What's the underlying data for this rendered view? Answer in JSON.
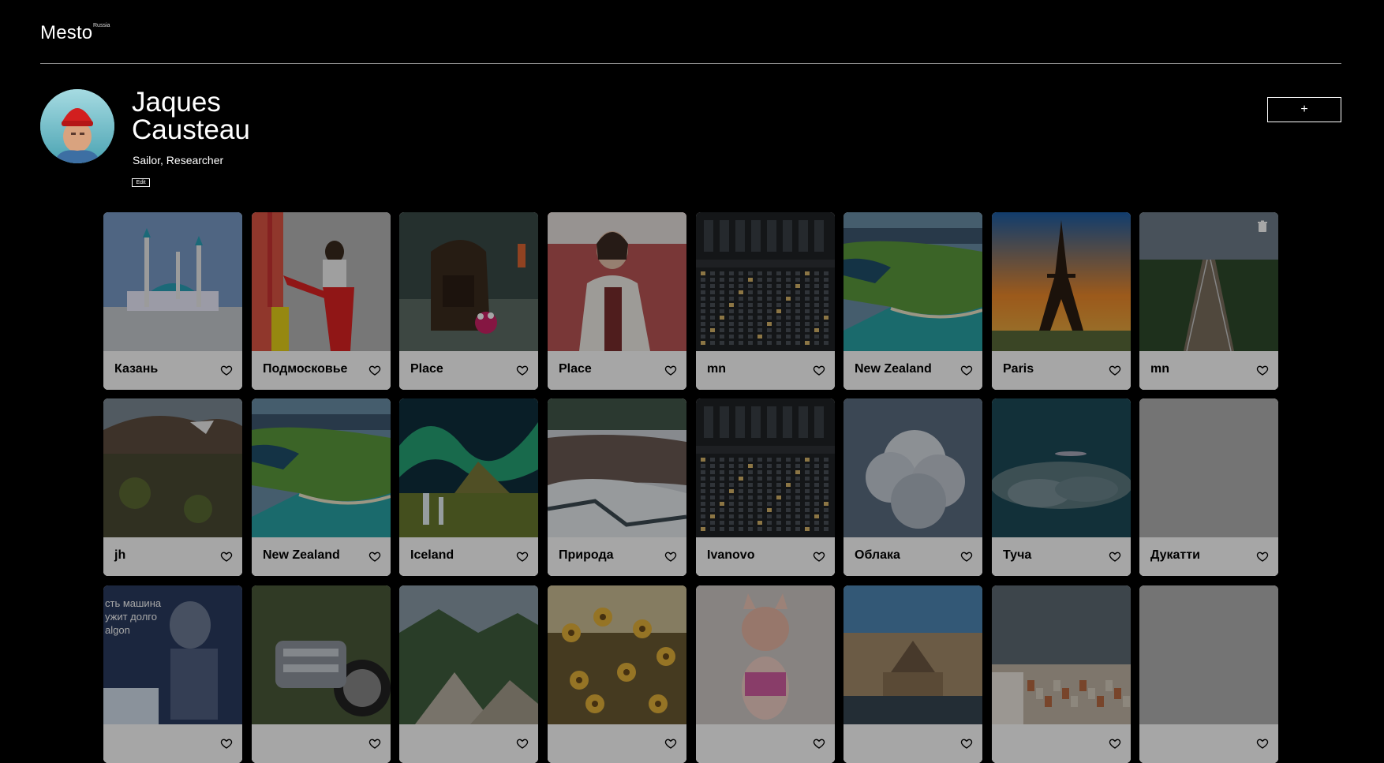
{
  "header": {
    "logo": "Mesto",
    "logo_sup": "Russia"
  },
  "profile": {
    "name": "Jaques Causteau",
    "about": "Sailor, Researcher",
    "edit_label": "Edit",
    "add_label": "+"
  },
  "cards": [
    {
      "title": "Казань",
      "img": "mosque"
    },
    {
      "title": "Подмосковье",
      "img": "person-red"
    },
    {
      "title": "Place",
      "img": "backpack"
    },
    {
      "title": "Place",
      "img": "woman-jacket"
    },
    {
      "title": "mn",
      "img": "building"
    },
    {
      "title": "New Zealand",
      "img": "coast"
    },
    {
      "title": "Paris",
      "img": "eiffel"
    },
    {
      "title": "mn",
      "img": "railway",
      "deletable": true
    },
    {
      "title": "jh",
      "img": "tundra"
    },
    {
      "title": "New Zealand",
      "img": "coast"
    },
    {
      "title": "Iceland",
      "img": "aurora"
    },
    {
      "title": "Природа",
      "img": "river"
    },
    {
      "title": "Ivanovo",
      "img": "building"
    },
    {
      "title": "Облака",
      "img": "clouds"
    },
    {
      "title": "Туча",
      "img": "storm"
    },
    {
      "title": "Дукатти",
      "img": "blank"
    },
    {
      "title": "",
      "img": "robot",
      "overlay_text": "сть машина\nужит долго\nalgon"
    },
    {
      "title": "",
      "img": "motorbike"
    },
    {
      "title": "",
      "img": "mountains"
    },
    {
      "title": "",
      "img": "flowers"
    },
    {
      "title": "",
      "img": "piggy"
    },
    {
      "title": "",
      "img": "museum"
    },
    {
      "title": "",
      "img": "town"
    },
    {
      "title": "",
      "img": "blank"
    }
  ],
  "icons": {
    "like": "heart-outline-icon",
    "delete": "trash-icon"
  }
}
